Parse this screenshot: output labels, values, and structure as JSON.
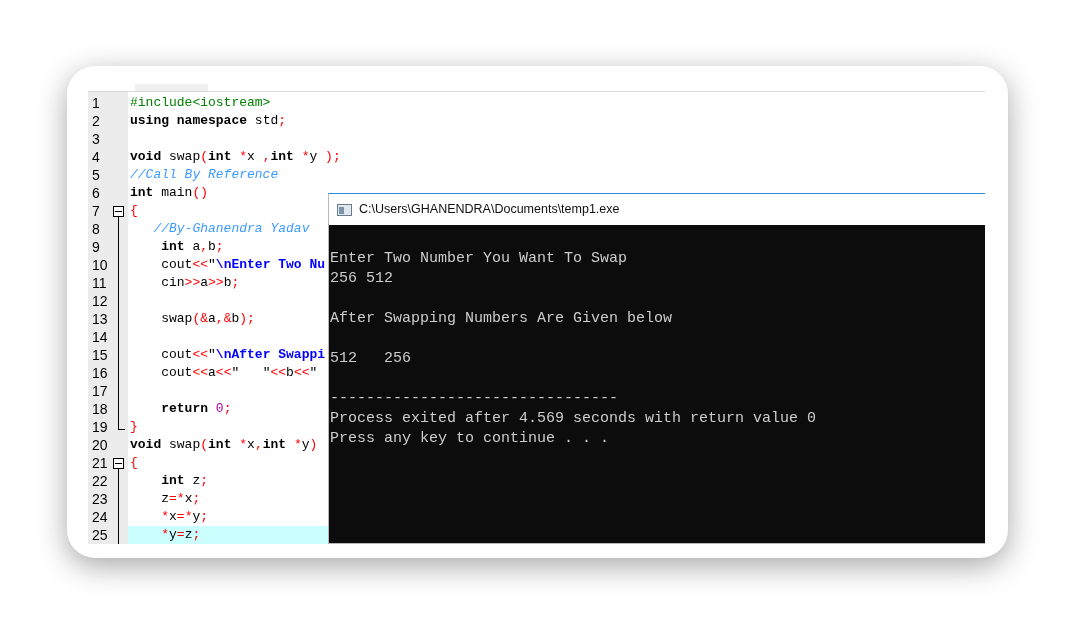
{
  "editor": {
    "lines": [
      {
        "number": "1",
        "tokens": [
          {
            "kind": "pp",
            "text": "#include<iostream>"
          }
        ]
      },
      {
        "number": "2",
        "tokens": [
          {
            "kind": "kw",
            "text": "using namespace"
          },
          {
            "kind": "pl",
            "text": " std"
          },
          {
            "kind": "p",
            "text": ";"
          }
        ]
      },
      {
        "number": "3"
      },
      {
        "number": "4",
        "tokens": [
          {
            "kind": "kw",
            "text": "void"
          },
          {
            "kind": "pl",
            "text": " swap"
          },
          {
            "kind": "p",
            "text": "("
          },
          {
            "kind": "kw",
            "text": "int"
          },
          {
            "kind": "p",
            "text": " *"
          },
          {
            "kind": "pl",
            "text": "x "
          },
          {
            "kind": "p",
            "text": ","
          },
          {
            "kind": "kw",
            "text": "int"
          },
          {
            "kind": "p",
            "text": " *"
          },
          {
            "kind": "pl",
            "text": "y "
          },
          {
            "kind": "p",
            "text": ");"
          }
        ]
      },
      {
        "number": "5",
        "tokens": [
          {
            "kind": "cm",
            "text": "//Call By Reference"
          }
        ]
      },
      {
        "number": "6",
        "tokens": [
          {
            "kind": "kw",
            "text": "int"
          },
          {
            "kind": "pl",
            "text": " main"
          },
          {
            "kind": "p",
            "text": "()"
          }
        ]
      },
      {
        "number": "7",
        "expanded": true,
        "tokens": [
          {
            "kind": "p",
            "text": "{"
          }
        ]
      },
      {
        "number": "8",
        "tokens": [
          {
            "kind": "cm",
            "text": "   //By-Ghanendra Yadav"
          }
        ]
      },
      {
        "number": "9",
        "tokens": [
          {
            "kind": "kw",
            "text": "    int"
          },
          {
            "kind": "pl",
            "text": " a"
          },
          {
            "kind": "p",
            "text": ","
          },
          {
            "kind": "pl",
            "text": "b"
          },
          {
            "kind": "p",
            "text": ";"
          }
        ]
      },
      {
        "number": "10",
        "tokens": [
          {
            "kind": "pl",
            "text": "    cout"
          },
          {
            "kind": "p",
            "text": "<<"
          },
          {
            "kind": "pl",
            "text": "\""
          },
          {
            "kind": "st",
            "text": "\\nEnter Two Nu"
          }
        ]
      },
      {
        "number": "11",
        "tokens": [
          {
            "kind": "pl",
            "text": "    cin"
          },
          {
            "kind": "p",
            "text": ">>"
          },
          {
            "kind": "pl",
            "text": "a"
          },
          {
            "kind": "p",
            "text": ">>"
          },
          {
            "kind": "pl",
            "text": "b"
          },
          {
            "kind": "p",
            "text": ";"
          }
        ]
      },
      {
        "number": "12"
      },
      {
        "number": "13",
        "tokens": [
          {
            "kind": "pl",
            "text": "    swap"
          },
          {
            "kind": "p",
            "text": "(&"
          },
          {
            "kind": "pl",
            "text": "a"
          },
          {
            "kind": "p",
            "text": ",&"
          },
          {
            "kind": "pl",
            "text": "b"
          },
          {
            "kind": "p",
            "text": ");"
          }
        ]
      },
      {
        "number": "14"
      },
      {
        "number": "15",
        "tokens": [
          {
            "kind": "pl",
            "text": "    cout"
          },
          {
            "kind": "p",
            "text": "<<"
          },
          {
            "kind": "pl",
            "text": "\""
          },
          {
            "kind": "st",
            "text": "\\nAfter Swappi"
          }
        ]
      },
      {
        "number": "16",
        "tokens": [
          {
            "kind": "pl",
            "text": "    cout"
          },
          {
            "kind": "p",
            "text": "<<"
          },
          {
            "kind": "pl",
            "text": "a"
          },
          {
            "kind": "p",
            "text": "<<"
          },
          {
            "kind": "pl",
            "text": "\"   \""
          },
          {
            "kind": "p",
            "text": "<<"
          },
          {
            "kind": "pl",
            "text": "b"
          },
          {
            "kind": "p",
            "text": "<<"
          },
          {
            "kind": "pl",
            "text": "\""
          }
        ]
      },
      {
        "number": "17"
      },
      {
        "number": "18",
        "tokens": [
          {
            "kind": "kw",
            "text": "    return "
          },
          {
            "kind": "nu",
            "text": "0"
          },
          {
            "kind": "p",
            "text": ";"
          }
        ]
      },
      {
        "number": "19",
        "fold_end": true,
        "tokens": [
          {
            "kind": "p",
            "text": "}"
          }
        ]
      },
      {
        "number": "20",
        "tokens": [
          {
            "kind": "kw",
            "text": "void"
          },
          {
            "kind": "pl",
            "text": " swap"
          },
          {
            "kind": "p",
            "text": "("
          },
          {
            "kind": "kw",
            "text": "int"
          },
          {
            "kind": "p",
            "text": " *"
          },
          {
            "kind": "pl",
            "text": "x"
          },
          {
            "kind": "p",
            "text": ","
          },
          {
            "kind": "kw",
            "text": "int"
          },
          {
            "kind": "p",
            "text": " *"
          },
          {
            "kind": "pl",
            "text": "y"
          },
          {
            "kind": "p",
            "text": ")"
          }
        ]
      },
      {
        "number": "21",
        "expanded": true,
        "tokens": [
          {
            "kind": "p",
            "text": "{"
          }
        ]
      },
      {
        "number": "22",
        "tokens": [
          {
            "kind": "kw",
            "text": "    int"
          },
          {
            "kind": "pl",
            "text": " z"
          },
          {
            "kind": "p",
            "text": ";"
          }
        ]
      },
      {
        "number": "23",
        "tokens": [
          {
            "kind": "pl",
            "text": "    z"
          },
          {
            "kind": "p",
            "text": "=*"
          },
          {
            "kind": "pl",
            "text": "x"
          },
          {
            "kind": "p",
            "text": ";"
          }
        ]
      },
      {
        "number": "24",
        "tokens": [
          {
            "kind": "p",
            "text": "    *"
          },
          {
            "kind": "pl",
            "text": "x"
          },
          {
            "kind": "p",
            "text": "=*"
          },
          {
            "kind": "pl",
            "text": "y"
          },
          {
            "kind": "p",
            "text": ";"
          }
        ]
      },
      {
        "number": "25",
        "selected": true,
        "tokens": [
          {
            "kind": "p",
            "text": "    *"
          },
          {
            "kind": "pl",
            "text": "y"
          },
          {
            "kind": "p",
            "text": "="
          },
          {
            "kind": "pl",
            "text": "z"
          },
          {
            "kind": "p",
            "text": ";"
          }
        ]
      }
    ]
  },
  "console": {
    "title": "C:\\Users\\GHANENDRA\\Documents\\temp1.exe",
    "output": [
      {
        "kind": "blank"
      },
      {
        "kind": "text",
        "text": "Enter Two Number You Want To Swap"
      },
      {
        "kind": "text",
        "text": "256 512"
      },
      {
        "kind": "blank"
      },
      {
        "kind": "text",
        "text": "After Swapping Numbers Are Given below"
      },
      {
        "kind": "blank"
      },
      {
        "kind": "text",
        "text": "512   256"
      },
      {
        "kind": "blank"
      },
      {
        "kind": "text",
        "text": "--------------------------------"
      },
      {
        "kind": "text",
        "text": "Process exited after 4.569 seconds with return value 0"
      },
      {
        "kind": "text",
        "text": "Press any key to continue . . ."
      }
    ]
  }
}
